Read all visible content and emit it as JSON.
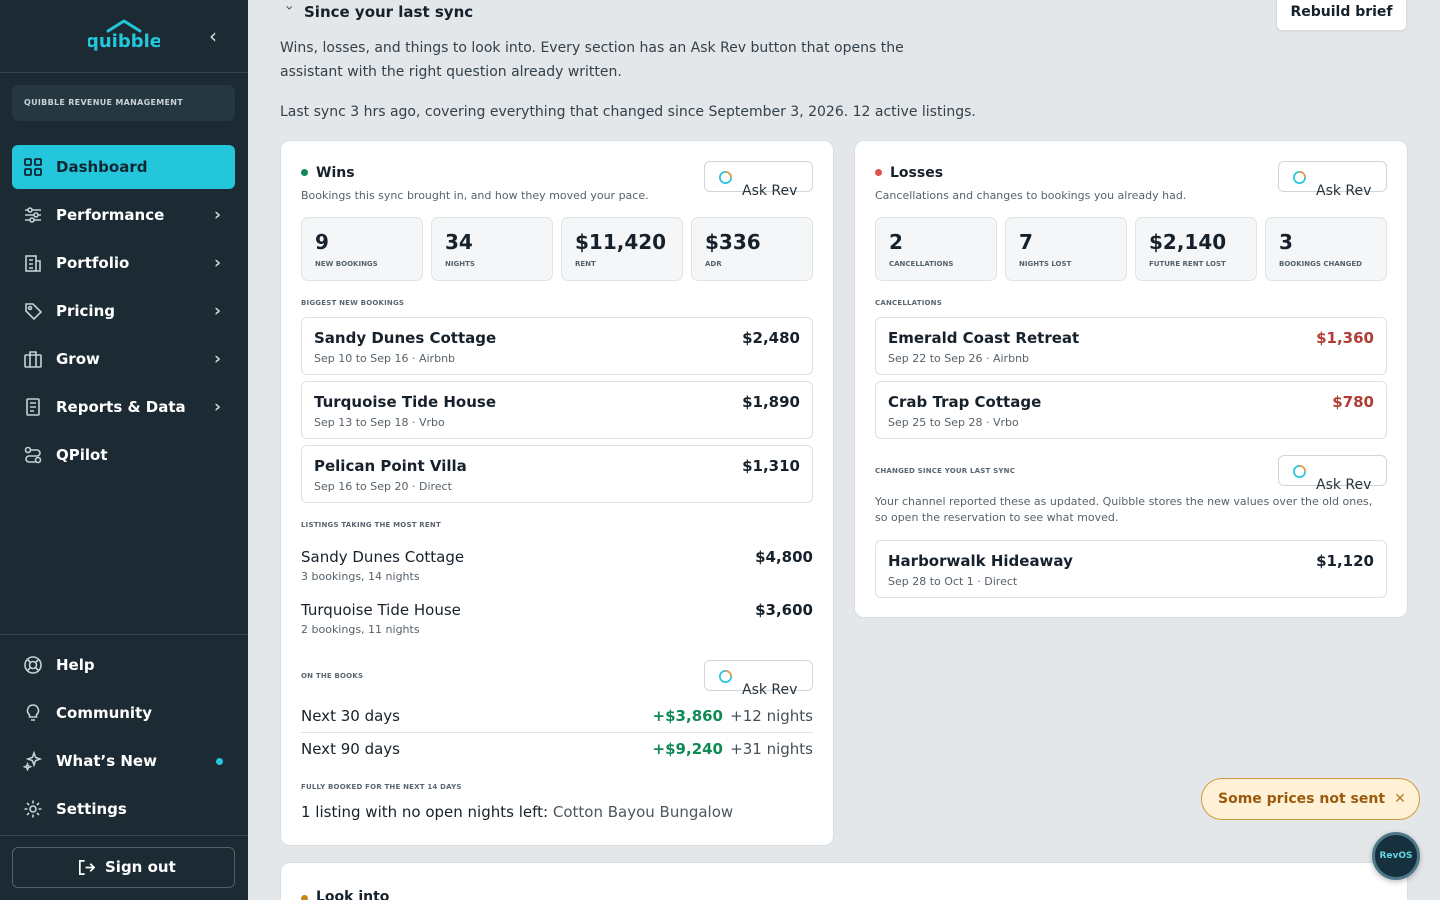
{
  "sidebar": {
    "brand": "quibble",
    "org_name": "QUIBBLE REVENUE MANAGEMENT",
    "nav": [
      {
        "label": "Dashboard",
        "icon": "grid-icon",
        "active": true
      },
      {
        "label": "Performance",
        "icon": "sliders-icon"
      },
      {
        "label": "Portfolio",
        "icon": "building-icon"
      },
      {
        "label": "Pricing",
        "icon": "tag-icon"
      },
      {
        "label": "Grow",
        "icon": "briefcase-icon"
      },
      {
        "label": "Reports & Data",
        "icon": "report-icon"
      },
      {
        "label": "QPilot",
        "icon": "route-icon"
      }
    ],
    "bottom": [
      {
        "label": "Help",
        "icon": "lifebuoy-icon"
      },
      {
        "label": "Community",
        "icon": "lightbulb-icon"
      },
      {
        "label": "What’s New",
        "icon": "sparkle-icon"
      },
      {
        "label": "Settings",
        "icon": "gear-icon"
      }
    ],
    "sign_out": "Sign out"
  },
  "main": {
    "section_title": "Since your last sync",
    "rebuild_label": "Rebuild brief",
    "description": "Wins, losses, and things to look into. Every section has an Ask Rev button that opens the assistant with the right question already written.",
    "last_sync": "Last sync 3 hrs ago, covering everything that changed since September 3, 2026. 12 active listings."
  },
  "ask_rev_label": "Ask Rev",
  "wins": {
    "title": "Wins",
    "description": "Bookings this sync brought in, and how they moved your pace.",
    "stats": [
      {
        "value": "9",
        "label": "NEW BOOKINGS"
      },
      {
        "value": "34",
        "label": "NIGHTS"
      },
      {
        "value": "$11,420",
        "label": "RENT"
      },
      {
        "value": "$336",
        "label": "ADR"
      }
    ],
    "bookings_header": "BIGGEST NEW BOOKINGS",
    "bookings": [
      {
        "name": "Sandy Dunes Cottage",
        "meta": "Sep 10 to Sep 16 · Airbnb",
        "amount": "$2,480"
      },
      {
        "name": "Turquoise Tide House",
        "meta": "Sep 13 to Sep 18 · Vrbo",
        "amount": "$1,890"
      },
      {
        "name": "Pelican Point Villa",
        "meta": "Sep 16 to Sep 20 · Direct",
        "amount": "$1,310"
      }
    ],
    "listings_header": "LISTINGS TAKING THE MOST RENT",
    "listings": [
      {
        "name": "Sandy Dunes Cottage",
        "meta": "3 bookings, 14 nights",
        "amount": "$4,800"
      },
      {
        "name": "Turquoise Tide House",
        "meta": "2 bookings, 11 nights",
        "amount": "$3,600"
      }
    ],
    "otb_header": "ON THE BOOKS",
    "otb": [
      {
        "label": "Next 30 days",
        "money": "+$3,860",
        "nights": "+12 nights"
      },
      {
        "label": "Next 90 days",
        "money": "+$9,240",
        "nights": "+31 nights"
      }
    ],
    "fully_booked_header": "FULLY BOOKED FOR THE NEXT 14 DAYS",
    "fully_booked_text": "1 listing with no open nights left:",
    "fully_booked_listing": "Cotton Bayou Bungalow"
  },
  "losses": {
    "title": "Losses",
    "description": "Cancellations and changes to bookings you already had.",
    "stats": [
      {
        "value": "2",
        "label": "CANCELLATIONS"
      },
      {
        "value": "7",
        "label": "NIGHTS LOST"
      },
      {
        "value": "$2,140",
        "label": "FUTURE RENT LOST"
      },
      {
        "value": "3",
        "label": "BOOKINGS CHANGED"
      }
    ],
    "cancellations_header": "CANCELLATIONS",
    "cancellations": [
      {
        "name": "Emerald Coast Retreat",
        "meta": "Sep 22 to Sep 26 · Airbnb",
        "amount": "$1,360"
      },
      {
        "name": "Crab Trap Cottage",
        "meta": "Sep 25 to Sep 28 · Vrbo",
        "amount": "$780"
      }
    ],
    "changed_header": "CHANGED SINCE YOUR LAST SYNC",
    "changed_description": "Your channel reported these as updated. Quibble stores the new values over the old ones, so open the reservation to see what moved.",
    "changed": [
      {
        "name": "Harborwalk Hideaway",
        "meta": "Sep 28 to Oct 1 · Direct",
        "amount": "$1,120"
      }
    ]
  },
  "look_into": {
    "title": "Look into"
  },
  "toast": {
    "label": "Some prices not sent"
  },
  "rev_button_label": "RevOS",
  "colors": {
    "accent": "#24c6dc",
    "sidebar": "#1c2b33",
    "win": "#0f8a55",
    "loss": "#b23b34",
    "look": "#c98519"
  }
}
